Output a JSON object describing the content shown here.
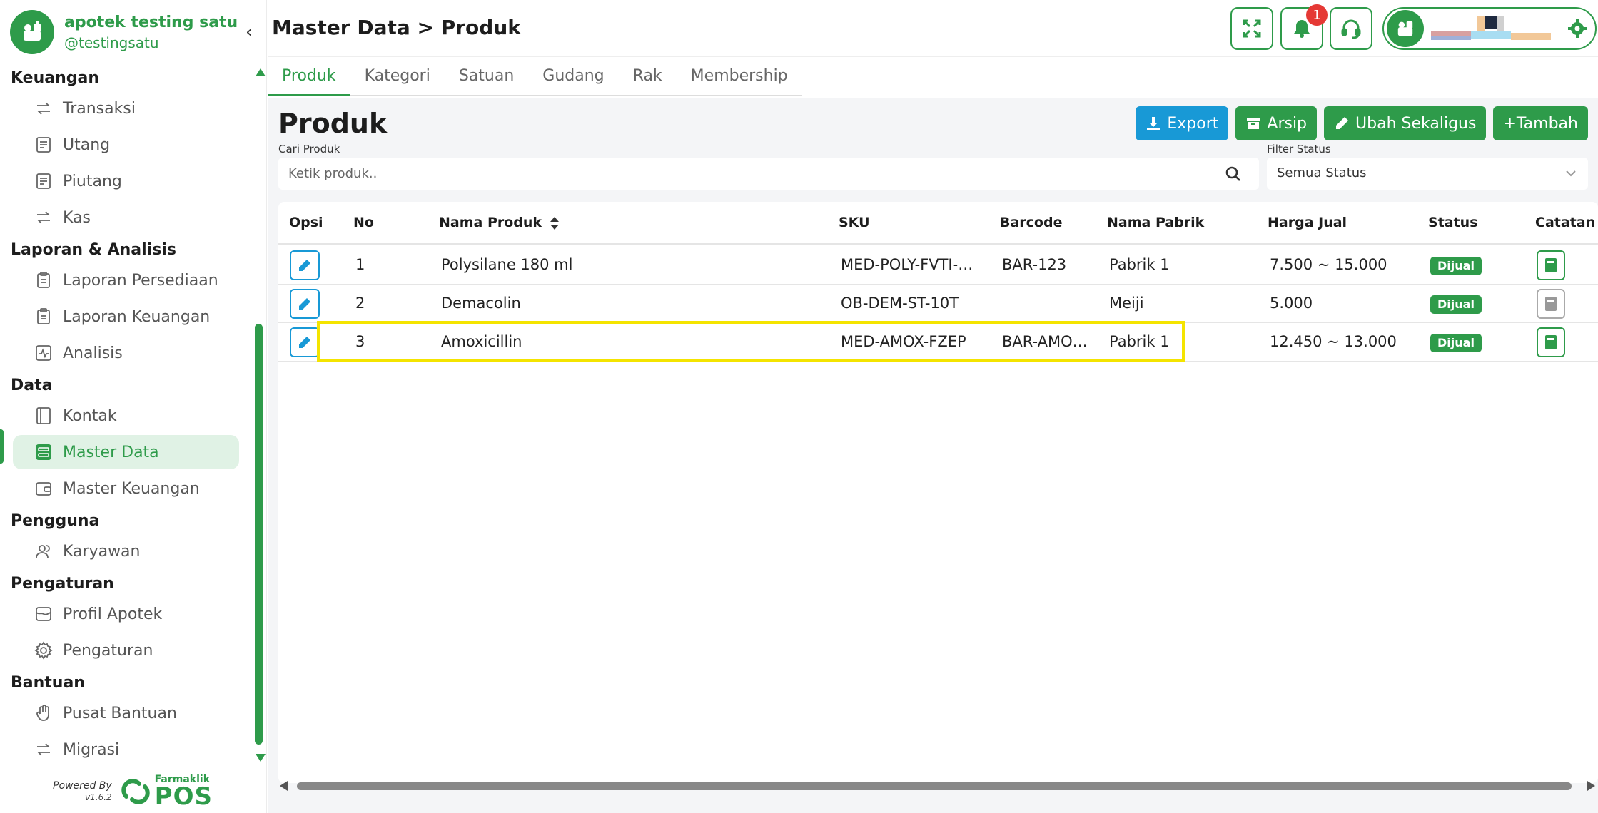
{
  "brand": {
    "name": "apotek testing satu",
    "handle": "@testingsatu"
  },
  "sidebar": {
    "sections": [
      {
        "title": "Keuangan",
        "items": [
          {
            "label": "Transaksi",
            "icon": "transfer-icon"
          },
          {
            "label": "Utang",
            "icon": "receipt-icon"
          },
          {
            "label": "Piutang",
            "icon": "receipt-icon"
          },
          {
            "label": "Kas",
            "icon": "transfer-icon"
          }
        ]
      },
      {
        "title": "Laporan & Analisis",
        "items": [
          {
            "label": "Laporan Persediaan",
            "icon": "clipboard-icon"
          },
          {
            "label": "Laporan Keuangan",
            "icon": "clipboard-icon"
          },
          {
            "label": "Analisis",
            "icon": "activity-icon"
          }
        ]
      },
      {
        "title": "Data",
        "items": [
          {
            "label": "Kontak",
            "icon": "contact-book-icon"
          },
          {
            "label": "Master Data",
            "icon": "database-icon",
            "active": true
          },
          {
            "label": "Master Keuangan",
            "icon": "wallet-icon"
          }
        ]
      },
      {
        "title": "Pengguna",
        "items": [
          {
            "label": "Karyawan",
            "icon": "users-icon"
          }
        ]
      },
      {
        "title": "Pengaturan",
        "items": [
          {
            "label": "Profil Apotek",
            "icon": "store-icon"
          },
          {
            "label": "Pengaturan",
            "icon": "gear-icon"
          }
        ]
      },
      {
        "title": "Bantuan",
        "items": [
          {
            "label": "Pusat Bantuan",
            "icon": "hand-icon"
          },
          {
            "label": "Migrasi",
            "icon": "transfer-icon"
          }
        ]
      }
    ]
  },
  "powered": {
    "label": "Powered By",
    "version": "v1.6.2",
    "logo_small": "Farmaklik",
    "logo_big": "POS"
  },
  "header": {
    "breadcrumb": "Master Data > Produk",
    "notification_count": "1"
  },
  "tabs": [
    "Produk",
    "Kategori",
    "Satuan",
    "Gudang",
    "Rak",
    "Membership"
  ],
  "page": {
    "title": "Produk",
    "actions": {
      "export": "Export",
      "arsip": "Arsip",
      "ubah": "Ubah Sekaligus",
      "tambah": "+Tambah"
    },
    "search": {
      "label": "Cari Produk",
      "placeholder": "Ketik produk.."
    },
    "filter": {
      "label": "Filter Status",
      "value": "Semua Status"
    }
  },
  "table": {
    "headers": [
      "Opsi",
      "No",
      "Nama Produk",
      "SKU",
      "Barcode",
      "Nama Pabrik",
      "Harga Jual",
      "Status",
      "Catatan"
    ],
    "rows": [
      {
        "no": "1",
        "nama": "Polysilane 180 ml",
        "sku": "MED-POLY-FVTI-…",
        "barcode": "BAR-123",
        "pabrik": "Pabrik 1",
        "harga": "7.500 ~ 15.000",
        "status": "Dijual",
        "catatan": true
      },
      {
        "no": "2",
        "nama": "Demacolin",
        "sku": "OB-DEM-ST-10T",
        "barcode": "",
        "pabrik": "Meiji",
        "harga": "5.000",
        "status": "Dijual",
        "catatan": false
      },
      {
        "no": "3",
        "nama": "Amoxicillin",
        "sku": "MED-AMOX-FZEP",
        "barcode": "BAR-AMO…",
        "pabrik": "Pabrik 1",
        "harga": "12.450 ~ 13.000",
        "status": "Dijual",
        "catatan": true
      }
    ]
  },
  "colors": {
    "brand_green": "#2e9b4a",
    "export_blue": "#1899d6",
    "highlight_yellow": "#f4e400",
    "badge_red": "#e53935"
  }
}
